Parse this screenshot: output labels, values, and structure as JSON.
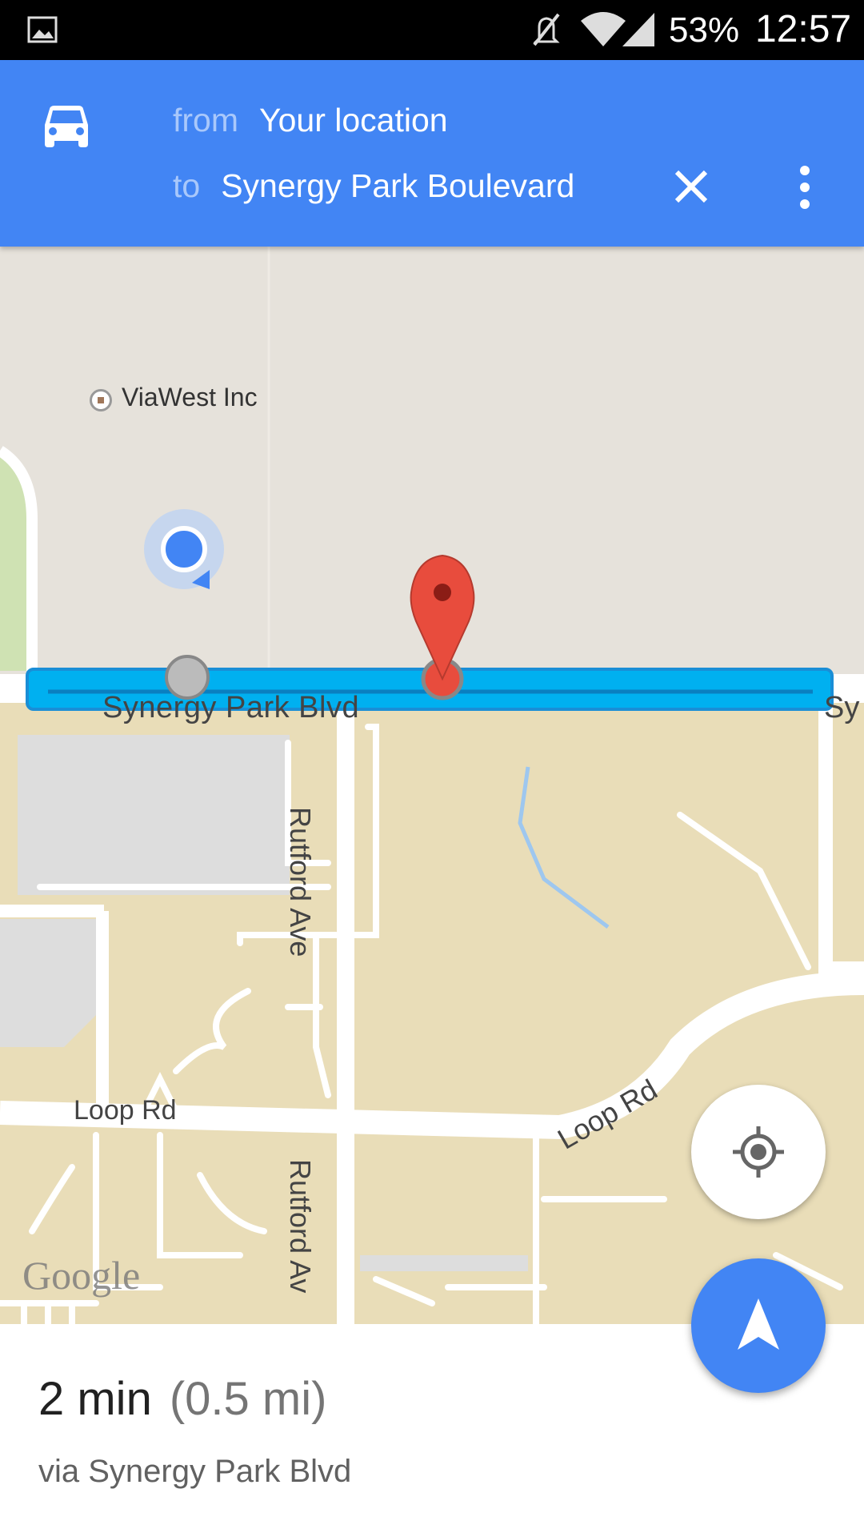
{
  "status_bar": {
    "battery": "53%",
    "time": "12:57",
    "icons": [
      "gallery-icon",
      "mute-icon",
      "wifi-icon",
      "signal-icon"
    ]
  },
  "directions_header": {
    "mode_icon": "car-icon",
    "from_label": "from",
    "from_value": "Your location",
    "to_label": "to",
    "to_value": "Synergy Park Boulevard",
    "close_icon": "close-icon",
    "menu_icon": "more-vert-icon"
  },
  "map": {
    "poi": "ViaWest Inc",
    "streets": {
      "synergy": "Synergy Park Blvd",
      "synergy_clipped": "Sy",
      "rutford_1": "Rutford Ave",
      "rutford_2": "Rutford Av",
      "loop_1": "Loop Rd",
      "loop_2": "Loop Rd"
    },
    "attribution": "Google"
  },
  "route_summary": {
    "duration": "2 min",
    "distance": "(0.5 mi)",
    "via": "via Synergy Park Blvd"
  },
  "colors": {
    "header_blue": "#4285f4",
    "route_blue": "#00b0f0",
    "pin_red": "#e84c3d",
    "map_land": "#e9ddb8",
    "map_built": "#e6e2db"
  }
}
